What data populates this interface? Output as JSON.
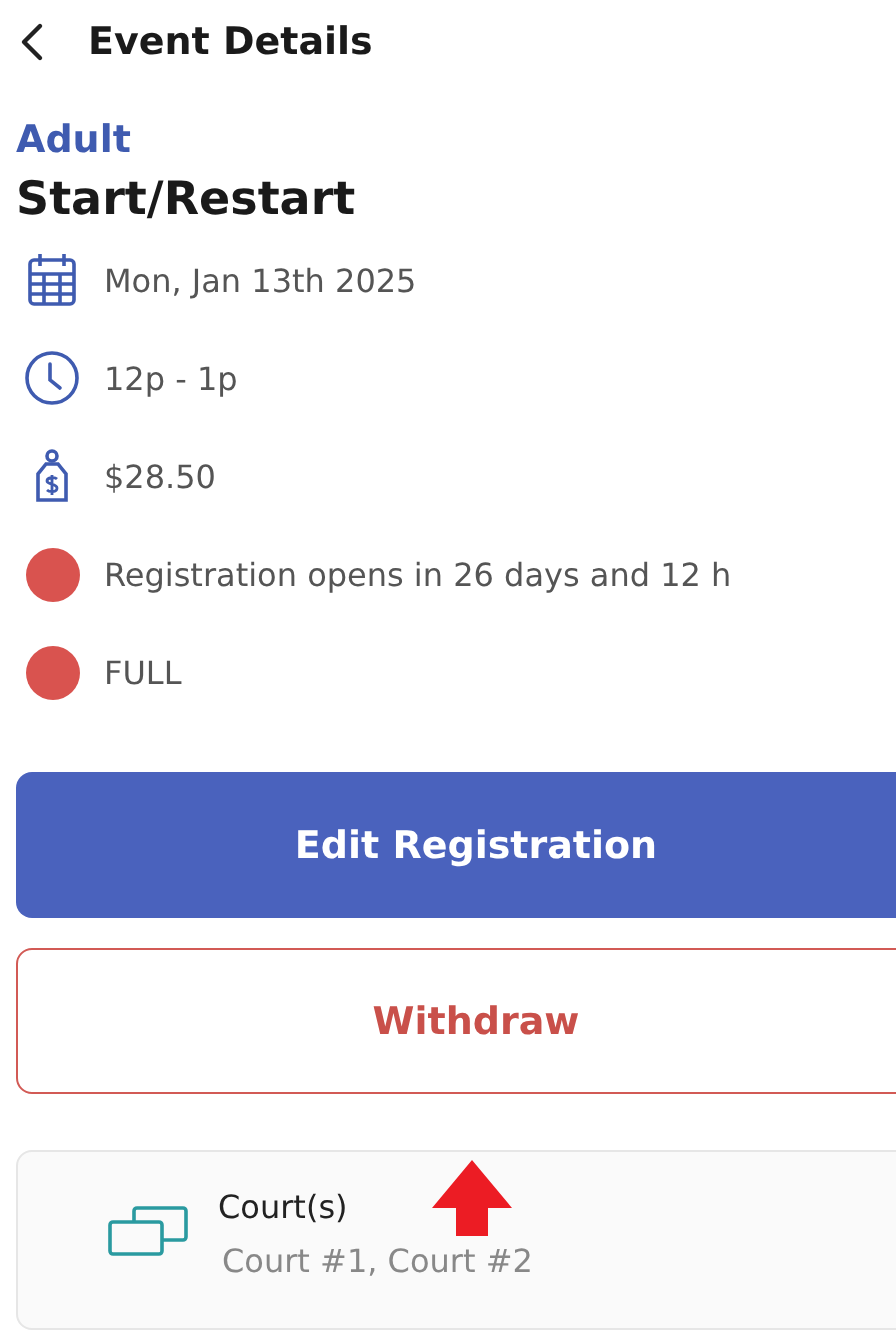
{
  "header": {
    "title": "Event Details"
  },
  "event": {
    "category": "Adult",
    "title": "Start/Restart"
  },
  "info_rows": [
    {
      "kind": "date",
      "text": "Mon, Jan 13th 2025"
    },
    {
      "kind": "time",
      "text": "12p - 1p"
    },
    {
      "kind": "price",
      "text": "$28.50"
    },
    {
      "kind": "status",
      "text": "Registration opens in 26 days and 12 h",
      "color": "#d9534f"
    },
    {
      "kind": "status",
      "text": "FULL",
      "color": "#d9534f"
    }
  ],
  "buttons": [
    {
      "kind": "primary",
      "label": "Edit Registration"
    },
    {
      "kind": "outline",
      "label": "Withdraw"
    }
  ],
  "courts_card": {
    "label": "Court(s)",
    "value": "Court #1, Court #2"
  },
  "annotation": {
    "kind": "arrow"
  }
}
